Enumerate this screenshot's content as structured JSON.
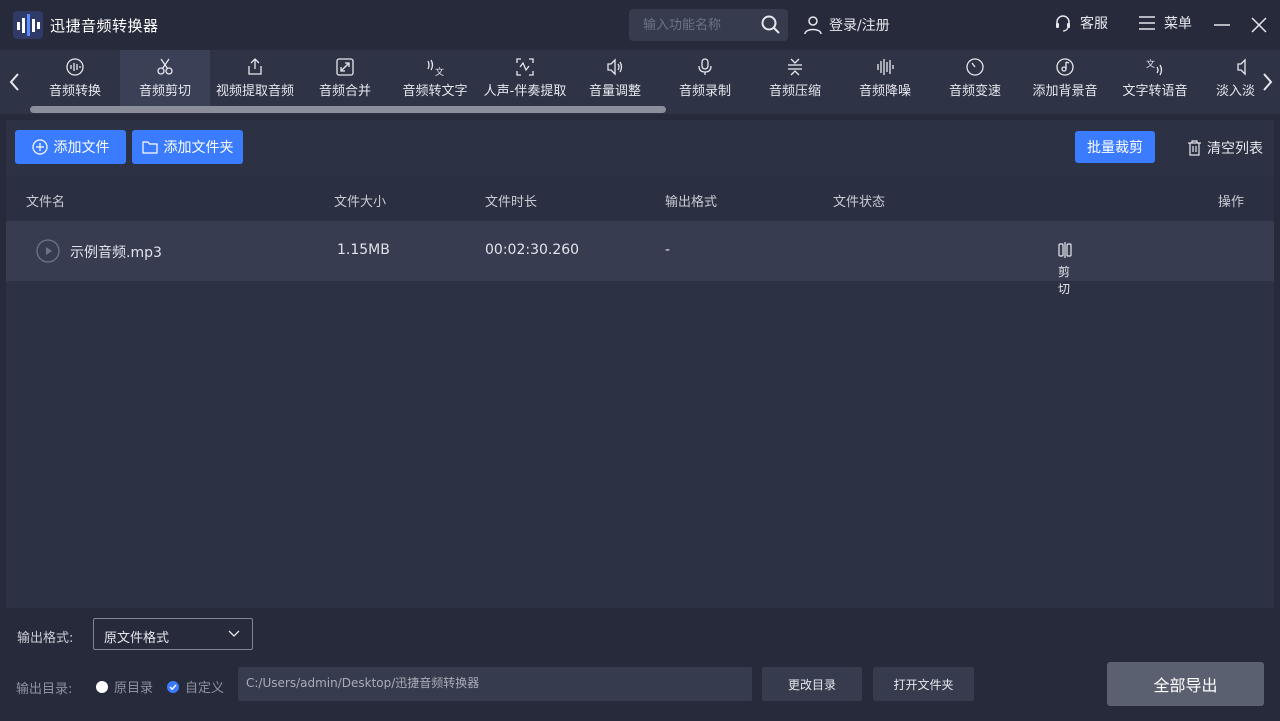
{
  "app": {
    "title": "迅捷音频转换器"
  },
  "header": {
    "search_placeholder": "输入功能名称",
    "login_label": "登录/注册",
    "service_label": "客服",
    "menu_label": "菜单"
  },
  "tools": [
    {
      "label": "音频转换",
      "icon": "waveform-circle-icon",
      "active": false
    },
    {
      "label": "音频剪切",
      "icon": "scissors-icon",
      "active": true
    },
    {
      "label": "视频提取音频",
      "icon": "share-upload-icon",
      "active": false
    },
    {
      "label": "音频合并",
      "icon": "merge-expand-icon",
      "active": false
    },
    {
      "label": "音频转文字",
      "icon": "speech-to-text-icon",
      "active": false
    },
    {
      "label": "人声-伴奏提取",
      "icon": "vocal-extract-icon",
      "active": false
    },
    {
      "label": "音量调整",
      "icon": "speaker-icon",
      "active": false
    },
    {
      "label": "音频录制",
      "icon": "microphone-icon",
      "active": false
    },
    {
      "label": "音频压缩",
      "icon": "compress-icon",
      "active": false
    },
    {
      "label": "音频降噪",
      "icon": "noise-bars-icon",
      "active": false
    },
    {
      "label": "音频变速",
      "icon": "speedometer-icon",
      "active": false
    },
    {
      "label": "添加背景音",
      "icon": "music-disc-icon",
      "active": false
    },
    {
      "label": "文字转语音",
      "icon": "text-to-speech-icon",
      "active": false
    },
    {
      "label": "淡入淡出",
      "icon": "fade-icon",
      "active": false
    }
  ],
  "actions": {
    "add_file": "添加文件",
    "add_folder": "添加文件夹",
    "batch_cut": "批量裁剪",
    "clear_list": "清空列表"
  },
  "table": {
    "headers": {
      "name": "文件名",
      "size": "文件大小",
      "duration": "文件时长",
      "format": "输出格式",
      "status": "文件状态",
      "action": "操作"
    },
    "rows": [
      {
        "name": "示例音频.mp3",
        "size": "1.15MB",
        "duration": "00:02:30.260",
        "format": "-",
        "status": "",
        "action_label": "剪切"
      }
    ]
  },
  "bottom": {
    "output_format_label": "输出格式:",
    "output_format_value": "原文件格式",
    "output_dir_label": "输出目录:",
    "radio_original": "原目录",
    "radio_custom": "自定义",
    "radio_selected": "custom",
    "path": "C:/Users/admin/Desktop/迅捷音频转换器",
    "change_dir": "更改目录",
    "open_folder": "打开文件夹",
    "export_all": "全部导出"
  },
  "colors": {
    "accent": "#3b7cff",
    "background": "#262a3a",
    "panel": "#2c3143",
    "row": "#373c50"
  }
}
